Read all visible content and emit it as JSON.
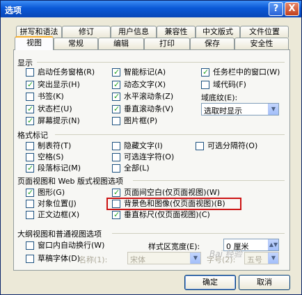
{
  "window": {
    "title": "选项",
    "help_glyph": "?",
    "close_glyph": "X"
  },
  "tabs_back": [
    "拼写和语法",
    "修订",
    "用户信息",
    "兼容性",
    "中文版式",
    "文件位置"
  ],
  "tabs_front": [
    "视图",
    "常规",
    "编辑",
    "打印",
    "保存",
    "安全性"
  ],
  "show": {
    "title": "显示",
    "col1": [
      {
        "label": "启动任务窗格(R)",
        "checked": false
      },
      {
        "label": "突出显示(H)",
        "checked": true
      },
      {
        "label": "书签(K)",
        "checked": false
      },
      {
        "label": "状态栏(U)",
        "checked": true
      },
      {
        "label": "屏幕提示(N)",
        "checked": true
      }
    ],
    "col2": [
      {
        "label": "智能标记(A)",
        "checked": true
      },
      {
        "label": "动态文字(X)",
        "checked": true
      },
      {
        "label": "水平滚动条(Z)",
        "checked": true
      },
      {
        "label": "垂直滚动条(V)",
        "checked": true
      },
      {
        "label": "图片框(P)",
        "checked": false
      }
    ],
    "col3": [
      {
        "label": "任务栏中的窗口(W)",
        "checked": true
      },
      {
        "label": "域代码(F)",
        "checked": false
      }
    ],
    "field_shading_label": "域底纹(E):",
    "field_shading_value": "选取时显示"
  },
  "format": {
    "title": "格式标记",
    "col1": [
      {
        "label": "制表符(T)",
        "checked": false
      },
      {
        "label": "空格(S)",
        "checked": false
      },
      {
        "label": "段落标记(M)",
        "checked": true
      }
    ],
    "col2": [
      {
        "label": "隐藏文字(I)",
        "checked": false
      },
      {
        "label": "可选连字符(O)",
        "checked": false
      },
      {
        "label": "全部(L)",
        "checked": false
      }
    ],
    "col3": [
      {
        "label": "可选分隔符(O)",
        "checked": false
      }
    ]
  },
  "layout": {
    "title": "页面视图和 Web 版式视图选项",
    "col1": [
      {
        "label": "图形(G)",
        "checked": true
      },
      {
        "label": "对象位置(J)",
        "checked": false
      },
      {
        "label": "正文边框(X)",
        "checked": false
      }
    ],
    "col2": [
      {
        "label": "页面间空白(仅页面视图)(W)",
        "checked": true
      },
      {
        "label": "背景色和图像(仅页面视图)(B)",
        "checked": false
      },
      {
        "label": "垂直标尺(仅页面视图)(C)",
        "checked": true
      }
    ]
  },
  "outline": {
    "title": "大纲视图和普通视图选项",
    "wrap": {
      "label": "窗口内自动换行(W)",
      "checked": false
    },
    "draft": {
      "label": "草稿字体(D)",
      "checked": false
    },
    "style_width_label": "样式区宽度(E):",
    "style_width_value": "0 厘米",
    "name_label": "名称(1):",
    "name_value": "宋体",
    "size_label": "字号(2):",
    "size_value": "五号"
  },
  "buttons": {
    "ok": "确定",
    "cancel": "取消"
  },
  "watermark": "Bai 经验"
}
